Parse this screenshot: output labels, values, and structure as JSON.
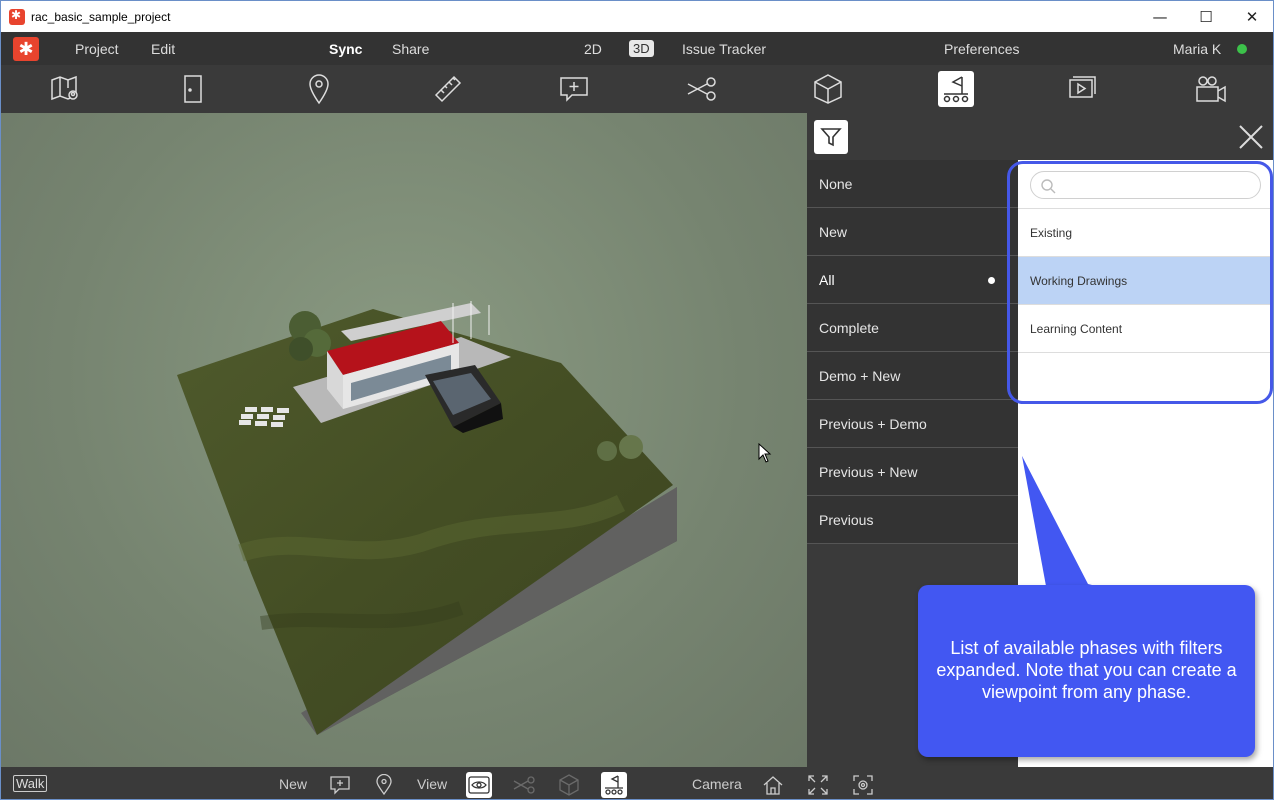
{
  "window": {
    "title": "rac_basic_sample_project",
    "minimize": "—",
    "maximize": "☐",
    "close": "✕"
  },
  "menu": {
    "project": "Project",
    "edit": "Edit",
    "sync": "Sync",
    "share": "Share",
    "view_2d": "2D",
    "view_3d": "3D",
    "issue_tracker": "Issue Tracker",
    "preferences": "Preferences",
    "user": "Maria K",
    "status_color": "#3cc24a"
  },
  "toolbar": {
    "icons": [
      "map-pin-icon",
      "door-icon",
      "location-icon",
      "ruler-icon",
      "comment-add-icon",
      "scissors-icon",
      "cube-icon",
      "phase-flag-icon",
      "slideshow-icon",
      "camera-icon"
    ],
    "active_icon": "phase-flag-icon"
  },
  "phases": {
    "items": [
      "None",
      "New",
      "All",
      "Complete",
      "Demo + New",
      "Previous + Demo",
      "Previous + New",
      "Previous"
    ],
    "selected": "All"
  },
  "phase_filter": {
    "search_placeholder": "",
    "items": [
      "Existing",
      "Working Drawings",
      "Learning Content"
    ],
    "highlighted": "Working Drawings"
  },
  "callout": {
    "text": "List of available phases with filters expanded. Note that you can create a viewpoint from any phase."
  },
  "bottom": {
    "walk": "Walk",
    "new": "New",
    "view": "View",
    "camera": "Camera"
  },
  "colors": {
    "accent": "#e8442e",
    "callout": "#4257f2",
    "highlight": "#bcd3f5"
  }
}
